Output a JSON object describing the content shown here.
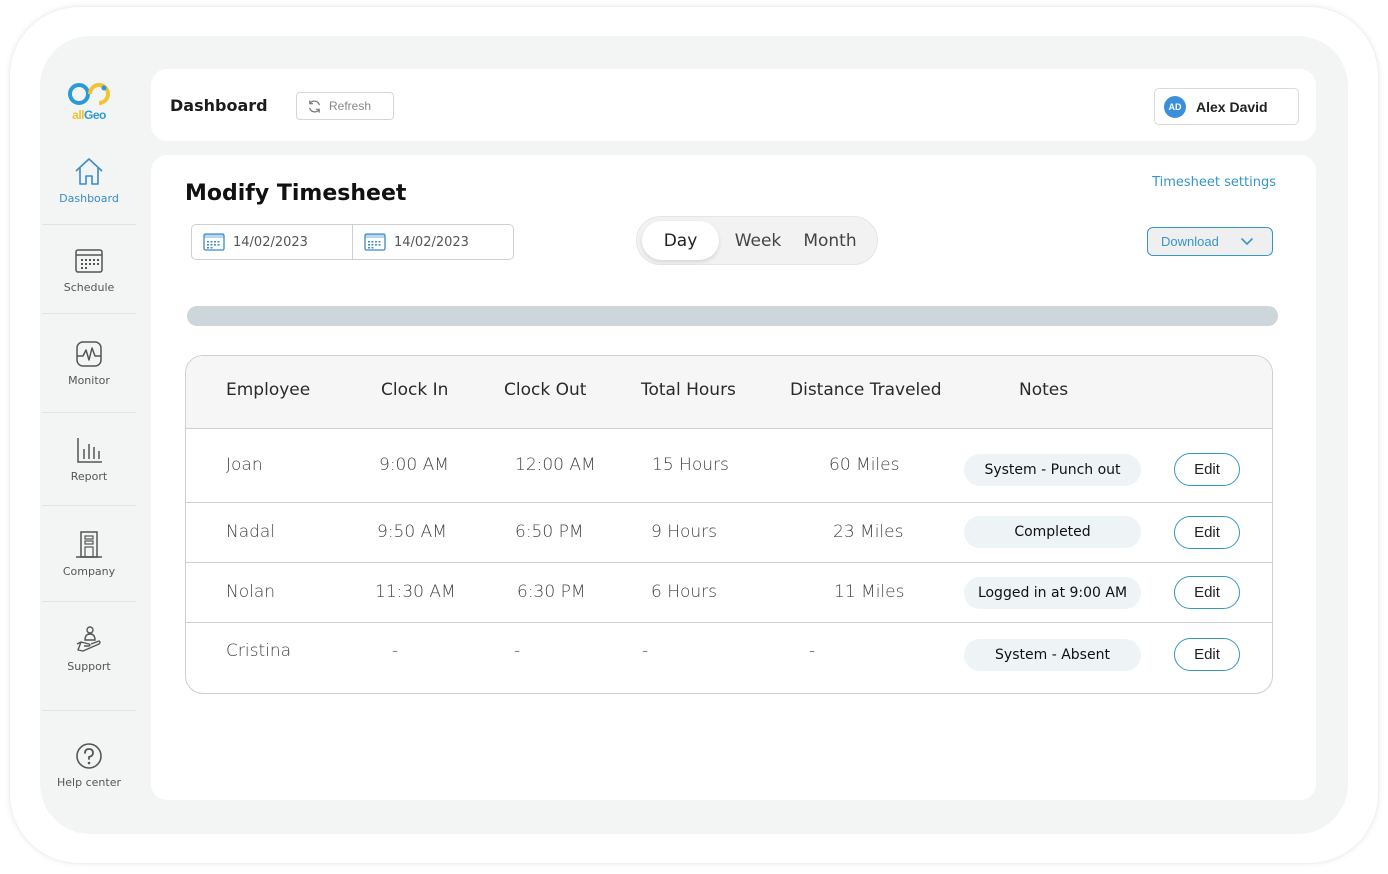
{
  "brand": {
    "logo_all": "all",
    "logo_geo": "Geo",
    "colors": {
      "accent": "#3596c8",
      "logo_yellow": "#f2c230",
      "logo_blue": "#2b9ad6"
    }
  },
  "sidebar": {
    "items": [
      {
        "label": "Dashboard",
        "icon": "home-icon",
        "active": true
      },
      {
        "label": "Schedule",
        "icon": "calendar-icon",
        "active": false
      },
      {
        "label": "Monitor",
        "icon": "pulse-monitor-icon",
        "active": false
      },
      {
        "label": "Report",
        "icon": "bar-chart-icon",
        "active": false
      },
      {
        "label": "Company",
        "icon": "building-icon",
        "active": false
      },
      {
        "label": "Support",
        "icon": "hand-person-icon",
        "active": false
      },
      {
        "label": "Help center",
        "icon": "question-circle-icon",
        "active": false
      }
    ]
  },
  "header": {
    "title": "Dashboard",
    "refresh_label": "Refresh",
    "user": {
      "initials": "AD",
      "name": "Alex David"
    }
  },
  "main": {
    "title": "Modify Timesheet",
    "settings_link": "Timesheet settings",
    "date_from": "14/02/2023",
    "date_to": "14/02/2023",
    "range_tabs": [
      {
        "label": "Day",
        "active": true
      },
      {
        "label": "Week",
        "active": false
      },
      {
        "label": "Month",
        "active": false
      }
    ],
    "download_label": "Download",
    "table": {
      "columns": [
        "Employee",
        "Clock In",
        "Clock Out",
        "Total Hours",
        "Distance Traveled",
        "Notes"
      ],
      "rows": [
        {
          "employee": "Joan",
          "clock_in": "9:00 AM",
          "clock_out": "12:00 AM",
          "total_hours": "15 Hours",
          "distance": "60 Miles",
          "note": "System - Punch out",
          "action": "Edit"
        },
        {
          "employee": "Nadal",
          "clock_in": "9:50 AM",
          "clock_out": "6:50 PM",
          "total_hours": "9 Hours",
          "distance": "23 Miles",
          "note": "Completed",
          "action": "Edit"
        },
        {
          "employee": "Nolan",
          "clock_in": "11:30 AM",
          "clock_out": "6:30 PM",
          "total_hours": "6 Hours",
          "distance": "11 Miles",
          "note": "Logged in at 9:00 AM",
          "action": "Edit"
        },
        {
          "employee": "Cristina",
          "clock_in": "-",
          "clock_out": "-",
          "total_hours": "-",
          "distance": "-",
          "note": "System - Absent",
          "action": "Edit"
        }
      ]
    }
  }
}
